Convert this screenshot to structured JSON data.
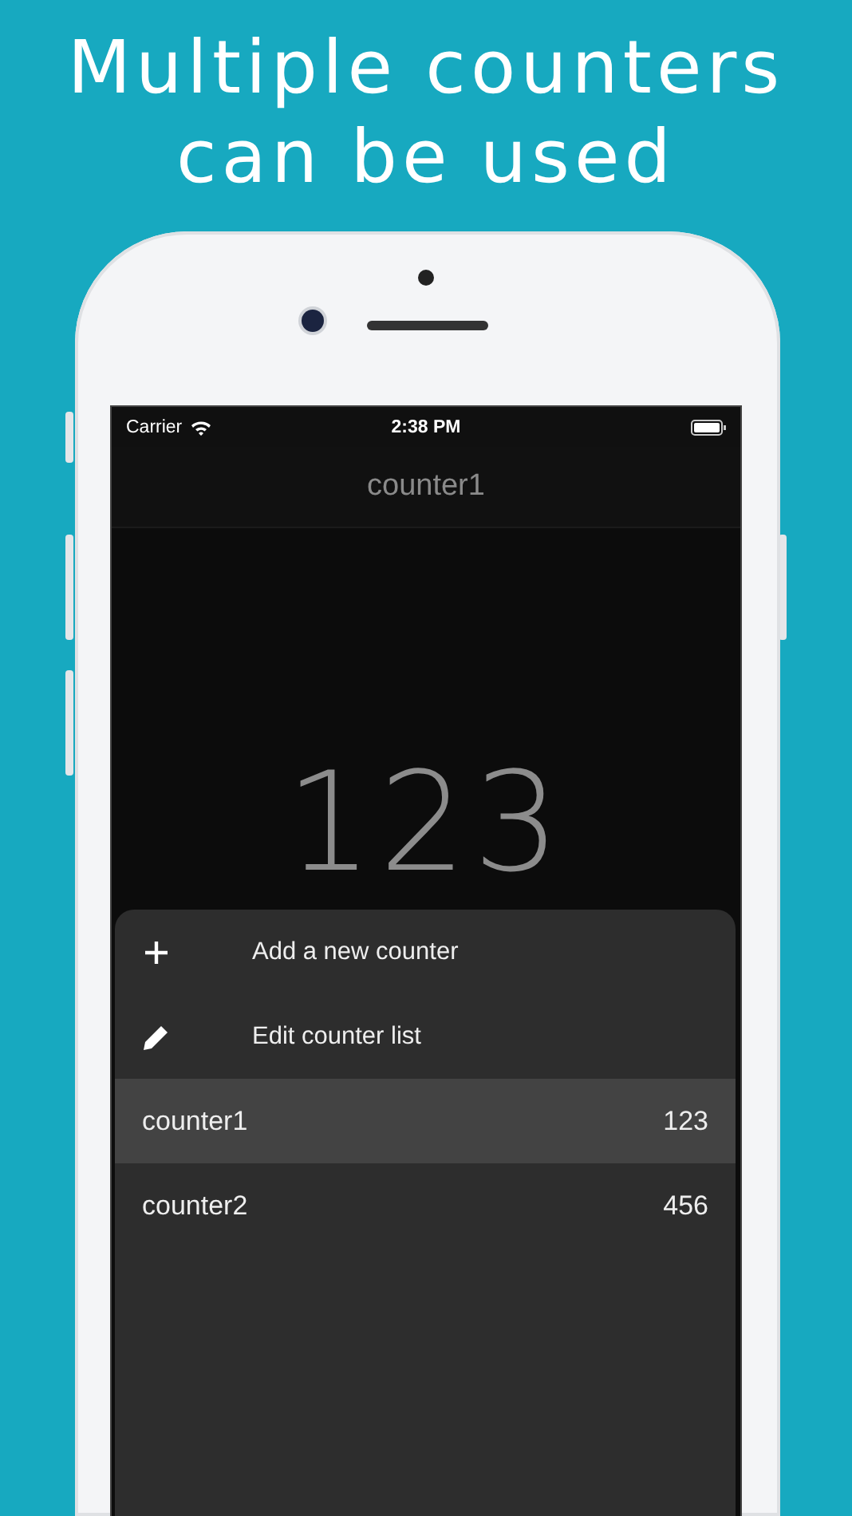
{
  "headline": "Multiple counters can be used",
  "status_bar": {
    "carrier": "Carrier",
    "time": "2:38 PM"
  },
  "nav_title": "counter1",
  "count": "123",
  "menu_actions": [
    {
      "kind": "add",
      "label": "Add a new counter"
    },
    {
      "kind": "edit",
      "label": "Edit counter list"
    }
  ],
  "counters": [
    {
      "name": "counter1",
      "value": "123",
      "selected": true
    },
    {
      "name": "counter2",
      "value": "456",
      "selected": false
    }
  ]
}
